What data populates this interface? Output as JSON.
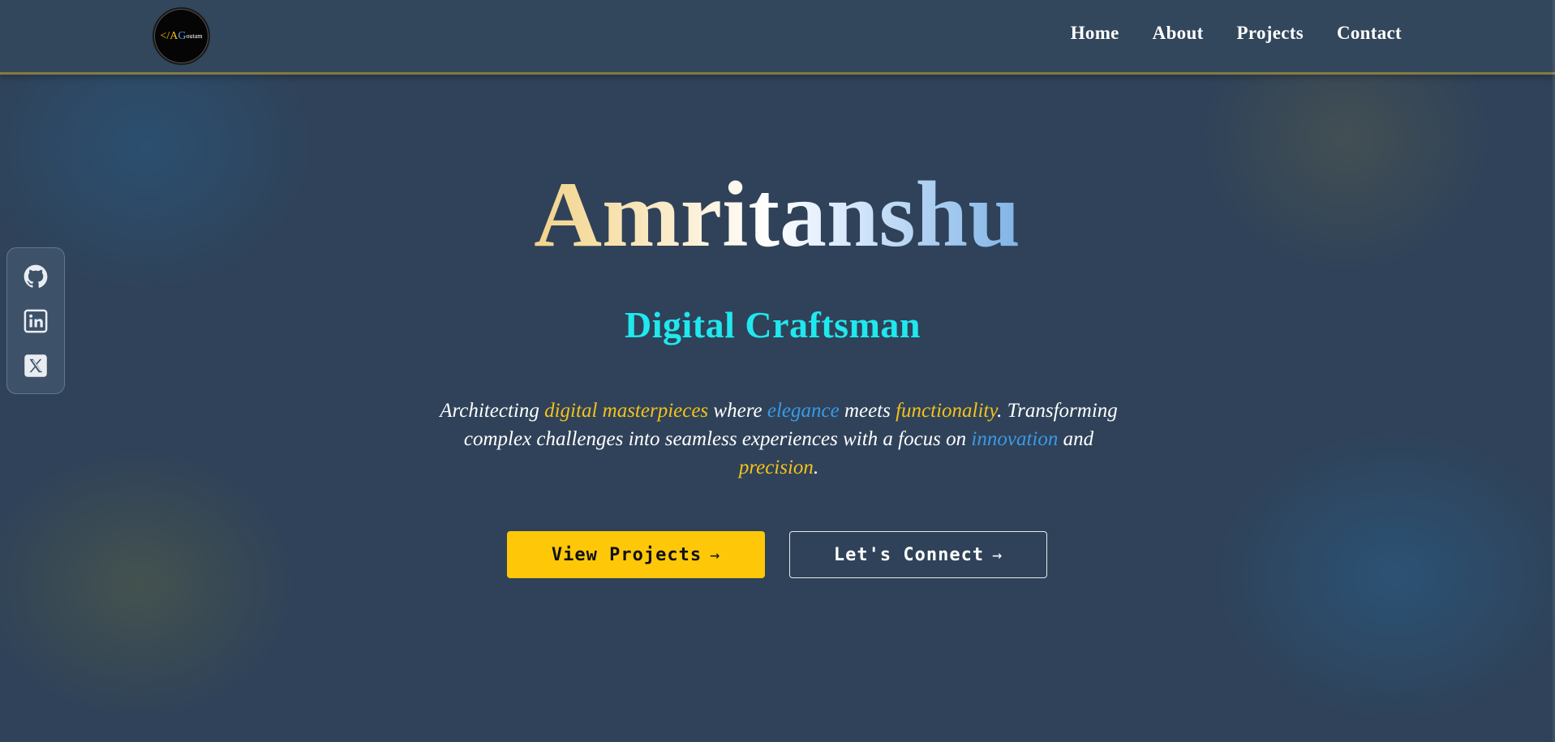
{
  "header": {
    "logo": {
      "prefix": "</",
      "a": "A",
      "g": "G",
      "rest": "outam"
    },
    "nav": [
      {
        "label": "Home"
      },
      {
        "label": "About"
      },
      {
        "label": "Projects"
      },
      {
        "label": "Contact"
      }
    ]
  },
  "social": [
    {
      "icon": "github-icon"
    },
    {
      "icon": "linkedin-icon"
    },
    {
      "icon": "x-twitter-icon"
    }
  ],
  "hero": {
    "name": "Amritanshu",
    "role": "Digital Craftsman",
    "description": {
      "t1": "Architecting ",
      "h1": "digital masterpieces",
      "t2": " where ",
      "h2": "elegance",
      "t3": " meets ",
      "h3": "functionality",
      "t4": ". Transforming complex challenges into seamless experiences with a focus on ",
      "h4": "innovation",
      "t5": " and ",
      "h5": "precision",
      "t6": "."
    },
    "primary_button": {
      "label": "View Projects",
      "arrow": "→"
    },
    "secondary_button": {
      "label": "Let's Connect",
      "arrow": "→"
    }
  },
  "colors": {
    "accent_gold": "#fec809",
    "accent_cyan": "#1fe8ee",
    "accent_blue": "#3a9ae8",
    "background": "#2f4259"
  }
}
